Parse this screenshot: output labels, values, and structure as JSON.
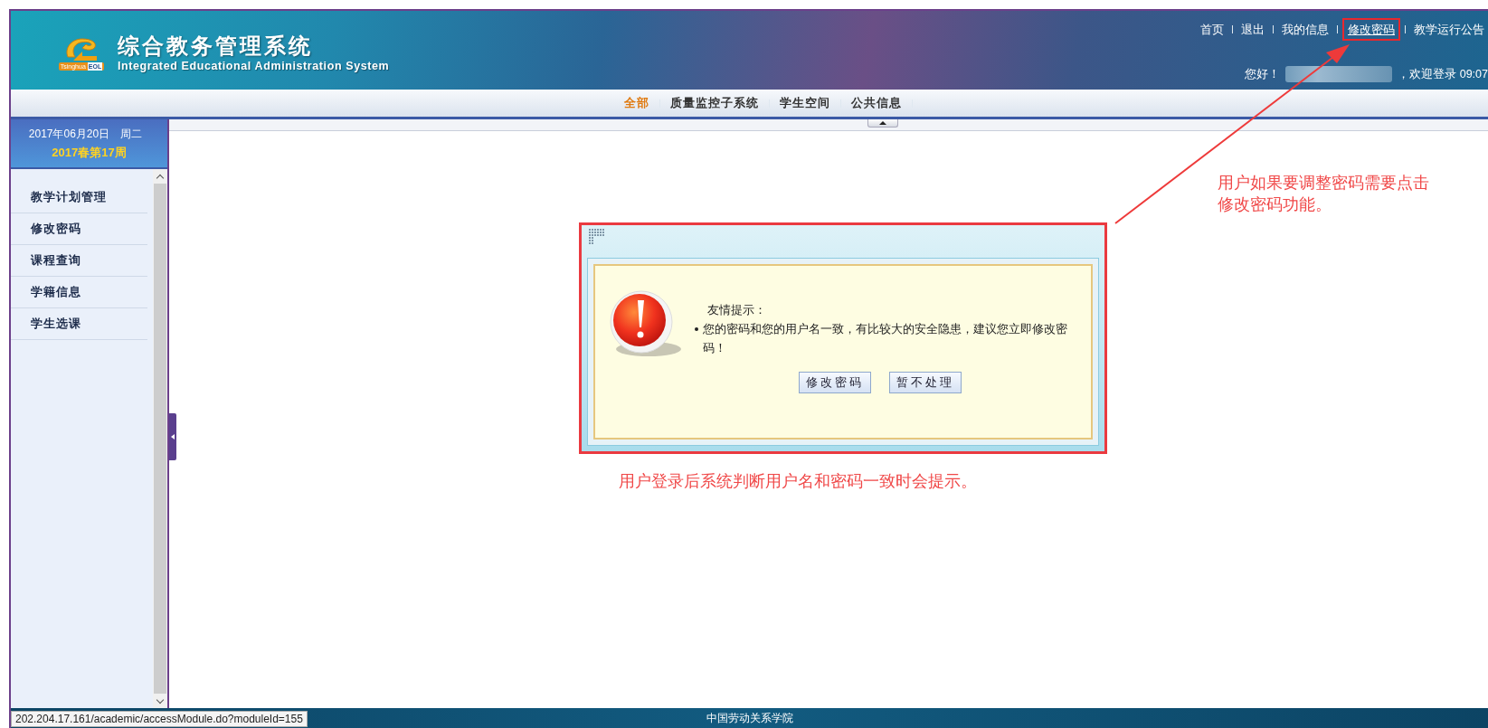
{
  "header": {
    "title": "综合教务管理系统",
    "subtitle": "Integrated Educational Administration System",
    "logo_caption": "Tsinghua",
    "logo_badge": "EOL"
  },
  "top_links": [
    {
      "label": "首页",
      "hovered": false
    },
    {
      "label": "退出",
      "hovered": false
    },
    {
      "label": "我的信息",
      "hovered": false
    },
    {
      "label": "修改密码",
      "hovered": true
    },
    {
      "label": "教学运行公告",
      "hovered": false
    }
  ],
  "greeting": "您好！",
  "welcome": "，欢迎登录 09:07",
  "nav": [
    {
      "label": "全部",
      "selected": true
    },
    {
      "label": "质量监控子系统",
      "selected": false
    },
    {
      "label": "学生空间",
      "selected": false
    },
    {
      "label": "公共信息",
      "selected": false
    }
  ],
  "sidebar": {
    "date": "2017年06月20日　周二",
    "week": "2017春第17周",
    "items": [
      "教学计划管理",
      "修改密码",
      "课程查询",
      "学籍信息",
      "学生选课"
    ]
  },
  "dialog": {
    "heading": "友情提示：",
    "message": "您的密码和您的用户名一致，有比较大的安全隐患，建议您立即修改密码！",
    "buttons": [
      "修改密码",
      "暂不处理"
    ]
  },
  "annotations": [
    "用户如果要调整密码需要点击修改密码功能。",
    "用户登录后系统判断用户名和密码一致时会提示。"
  ],
  "status_url": "202.204.17.161/academic/accessModule.do?moduleId=155",
  "footer": "中国劳动关系学院"
}
